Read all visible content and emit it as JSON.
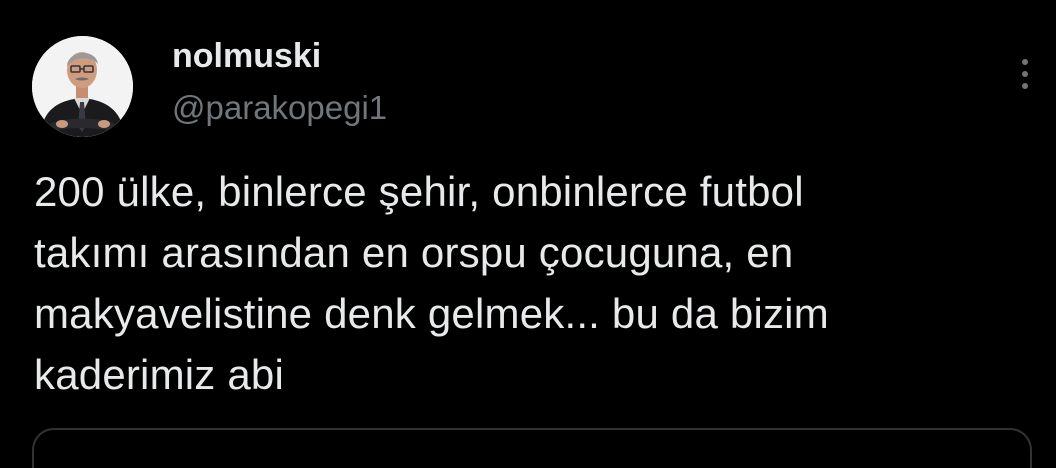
{
  "tweet": {
    "author": {
      "display_name": "nolmuski",
      "handle": "@parakopegi1"
    },
    "text": "200 ülke, binlerce şehir, onbinlerce futbol\ntakımı arasından en orspu çocuguna, en\nmakyavelistine denk gelmek... bu da bizim\nkaderimiz abi",
    "more_icon": "more-vertical-icon"
  },
  "colors": {
    "background": "#000000",
    "primary_text": "#e7e9ea",
    "secondary_text": "#71767b"
  }
}
